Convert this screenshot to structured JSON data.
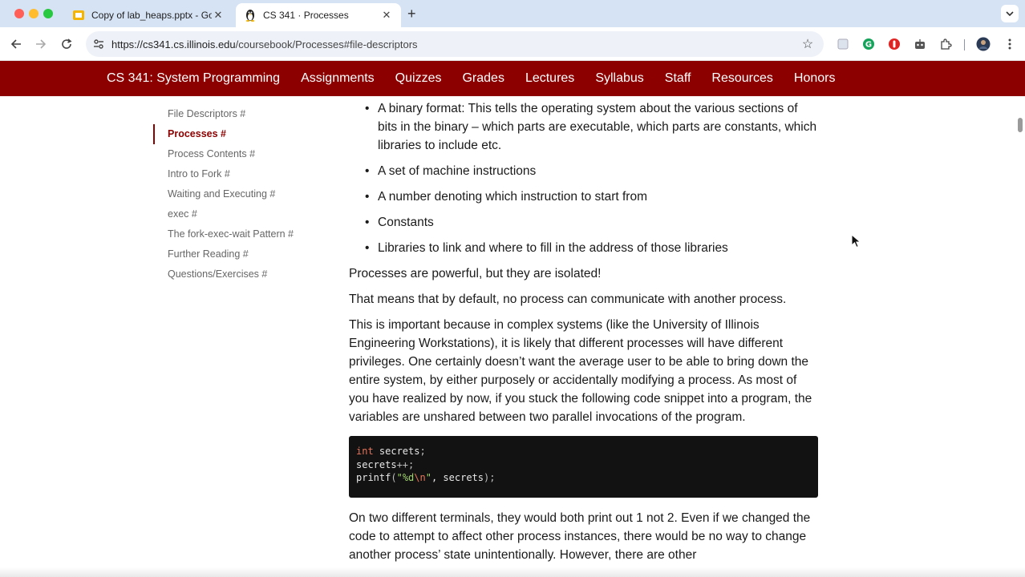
{
  "browser": {
    "tabs": [
      {
        "title": "Copy of lab_heaps.pptx - Goo",
        "icon": "google-slides-icon",
        "active": false
      },
      {
        "title": "CS 341 · Processes",
        "icon": "linux-penguin-icon",
        "active": true
      }
    ],
    "close_glyph": "✕",
    "new_tab_glyph": "+",
    "url_host": "https://cs341.cs.illinois.edu",
    "url_path": "/coursebook/Processes#file-descriptors",
    "colors": {
      "tabstrip": "#d6e3f4",
      "omnibox": "#eef2f8"
    }
  },
  "site_nav": {
    "brand": "CS 341: System Programming",
    "links": [
      "Assignments",
      "Quizzes",
      "Grades",
      "Lectures",
      "Syllabus",
      "Staff",
      "Resources",
      "Honors"
    ],
    "color": "#8c0000"
  },
  "sidebar": {
    "items": [
      {
        "label": "File Descriptors #",
        "active": false
      },
      {
        "label": "Processes #",
        "active": true
      },
      {
        "label": "Process Contents #",
        "active": false
      },
      {
        "label": "Intro to Fork #",
        "active": false
      },
      {
        "label": "Waiting and Executing #",
        "active": false
      },
      {
        "label": "exec #",
        "active": false
      },
      {
        "label": "The fork-exec-wait Pattern #",
        "active": false
      },
      {
        "label": "Further Reading #",
        "active": false
      },
      {
        "label": "Questions/Exercises #",
        "active": false
      }
    ]
  },
  "content": {
    "bullets": [
      "A binary format: This tells the operating system about the various sections of bits in the binary – which parts are executable, which parts are constants, which libraries to include etc.",
      "A set of machine instructions",
      "A number denoting which instruction to start from",
      "Constants",
      "Libraries to link and where to fill in the address of those libraries"
    ],
    "p1": "Processes are powerful, but they are isolated!",
    "p2": "That means that by default, no process can communicate with another process.",
    "p3": "This is important because in complex systems (like the University of Illinois Engineering Workstations), it is likely that different processes will have different privileges. One certainly doesn’t want the average user to be able to bring down the entire system, by either purposely or accidentally modifying a process. As most of you have realized by now, if you stuck the following code snippet into a program, the variables are unshared between two parallel invocations of the program.",
    "code": {
      "line1_kw": "int",
      "line1_rest": " secrets",
      "line1_punct": ";",
      "line2_text": "secrets",
      "line2_punct": "++;",
      "line3_fn": "printf",
      "line3_open": "(",
      "line3_str": "\"%d",
      "line3_esc": "\\n",
      "line3_strend": "\"",
      "line3_mid": ", secrets",
      "line3_close": ");"
    },
    "p4": "On two different terminals, they would both print out 1 not 2. Even if we changed the code to attempt to affect other process instances, there would be no way to change another process’ state unintentionally. However, there are other"
  }
}
